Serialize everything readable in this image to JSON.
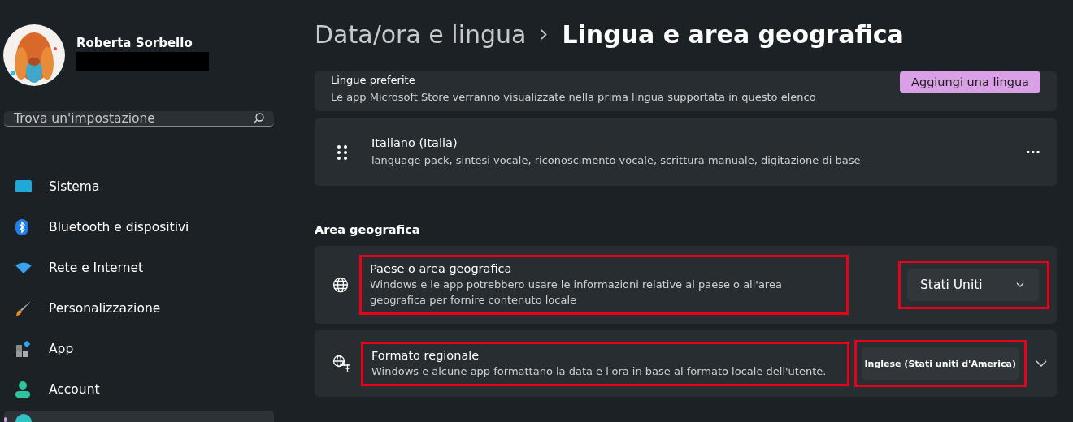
{
  "user": {
    "name": "Roberta Sorbello"
  },
  "search": {
    "placeholder": "Trova un'impostazione"
  },
  "sidebar": {
    "items": [
      {
        "label": "Sistema",
        "kind": "system",
        "selected": false
      },
      {
        "label": "Bluetooth e dispositivi",
        "kind": "bluetooth",
        "selected": false
      },
      {
        "label": "Rete e Internet",
        "kind": "network",
        "selected": false
      },
      {
        "label": "Personalizzazione",
        "kind": "brush",
        "selected": false
      },
      {
        "label": "App",
        "kind": "apps",
        "selected": false
      },
      {
        "label": "Account",
        "kind": "account",
        "selected": false
      },
      {
        "kind": "time",
        "selected": true
      }
    ]
  },
  "breadcrumb": [
    "Data/ora e lingua",
    "Lingua e area geografica"
  ],
  "preferred_languages": {
    "title": "Lingue preferite",
    "description": "Le app Microsoft Store verranno visualizzate nella prima lingua supportata in questo elenco",
    "button": "Aggiungi una lingua"
  },
  "languages": [
    {
      "name": "Italiano (Italia)",
      "features": "language pack, sintesi vocale, riconoscimento vocale, scrittura manuale, digitazione di base",
      "more": "···"
    }
  ],
  "region": {
    "heading": "Area geografica",
    "rows": [
      {
        "kind": "country",
        "title": "Paese o area geografica",
        "description": "Windows e le app potrebbero usare le informazioni relative al paese o all'area geografica per fornire contenuto locale",
        "value": "Stati Uniti",
        "highlighted": true,
        "expandable": false
      },
      {
        "kind": "format",
        "title": "Formato regionale",
        "description": "Windows e alcune app formattano la data e l'ora in base al formato locale dell'utente.",
        "value": "Inglese (Stati uniti d'America)",
        "highlighted": true,
        "expandable": true
      }
    ]
  }
}
